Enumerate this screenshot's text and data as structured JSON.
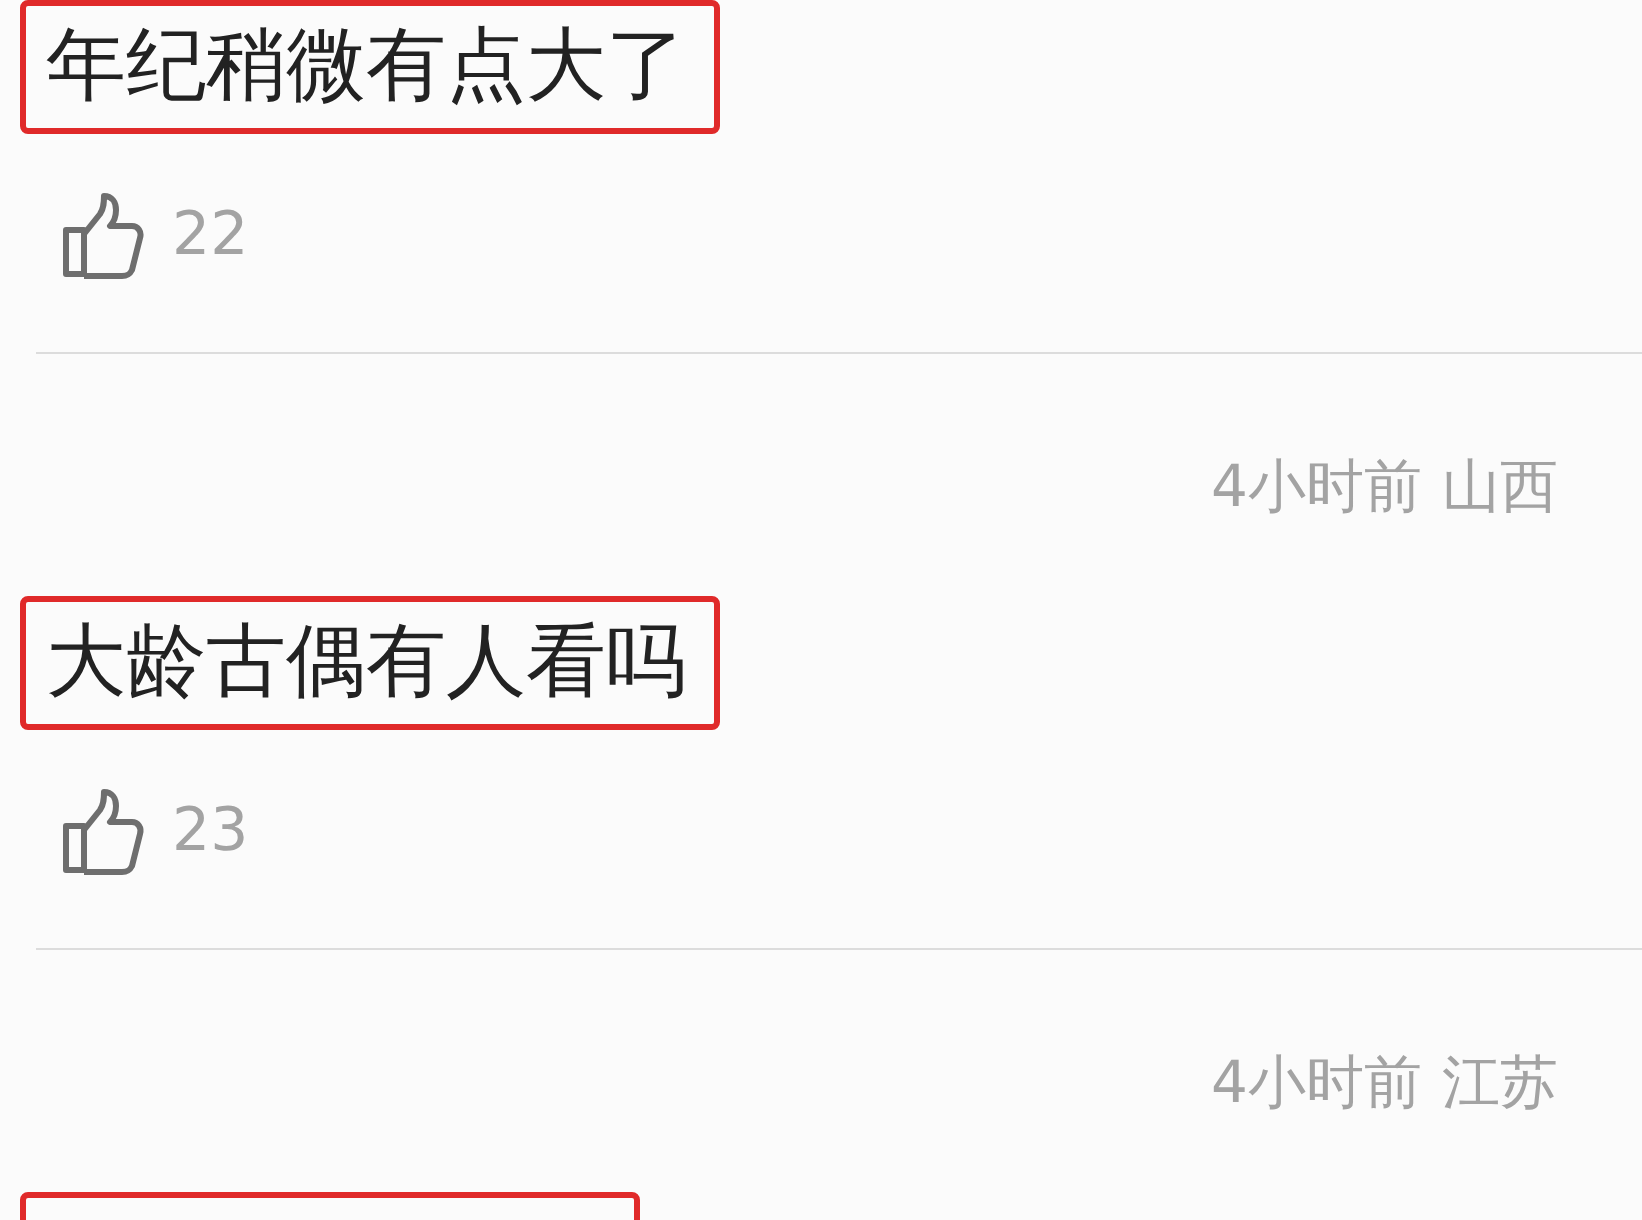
{
  "comments": [
    {
      "text": "年纪稍微有点大了",
      "highlighted": true,
      "likes": "22"
    },
    {
      "time": "4小时前",
      "location": "山西",
      "text": "大龄古偶有人看吗",
      "highlighted": true,
      "likes": "23"
    },
    {
      "time": "4小时前",
      "location": "江苏",
      "highlighted": true
    }
  ]
}
